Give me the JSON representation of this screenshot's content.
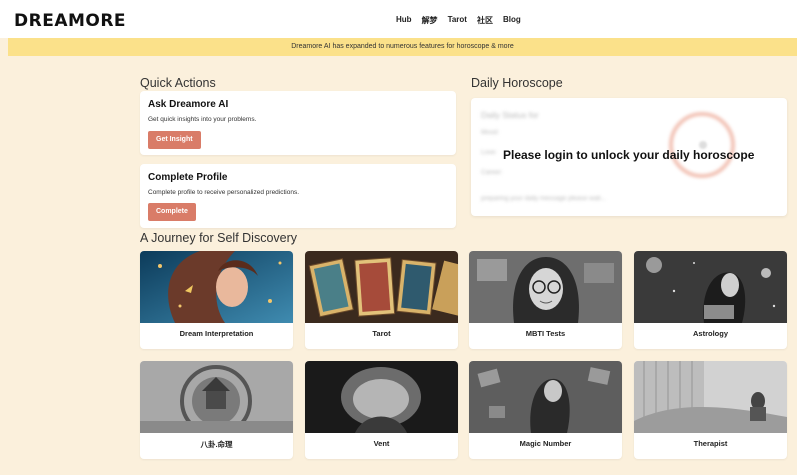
{
  "header": {
    "logo": "DREAMORE",
    "nav": [
      "Hub",
      "解梦",
      "Tarot",
      "社区",
      "Blog"
    ]
  },
  "banner": {
    "text": "Dreamore AI has expanded to numerous features for horoscope & more"
  },
  "quick_actions": {
    "title": "Quick Actions",
    "cards": [
      {
        "title": "Ask Dreamore AI",
        "desc": "Get quick insights into your problems.",
        "button": "Get Insight"
      },
      {
        "title": "Complete Profile",
        "desc": "Complete profile to receive personalized predictions.",
        "button": "Complete"
      }
    ]
  },
  "daily_horoscope": {
    "title": "Daily Horoscope",
    "blurred_lines": [
      "Daily Status for",
      "Mood:",
      "Love:",
      "Career:",
      "preparing your daily message please wait..."
    ],
    "lock_message": "Please login to unlock your daily horoscope"
  },
  "journey": {
    "title": "A Journey for Self Discovery",
    "tiles": [
      {
        "label": "Dream Interpretation",
        "icon": "dream-woman-image"
      },
      {
        "label": "Tarot",
        "icon": "tarot-cards-image"
      },
      {
        "label": "MBTI Tests",
        "icon": "mbti-portrait-image"
      },
      {
        "label": "Astrology",
        "icon": "astrology-woman-image"
      },
      {
        "label": "八卦.命理",
        "icon": "bagua-compass-image"
      },
      {
        "label": "Vent",
        "icon": "vent-cave-image"
      },
      {
        "label": "Magic Number",
        "icon": "magic-number-image"
      },
      {
        "label": "Therapist",
        "icon": "therapist-room-image"
      }
    ]
  },
  "colors": {
    "background": "#fbf0dc",
    "banner": "#fbe18a",
    "accent_button": "#d97c68"
  }
}
